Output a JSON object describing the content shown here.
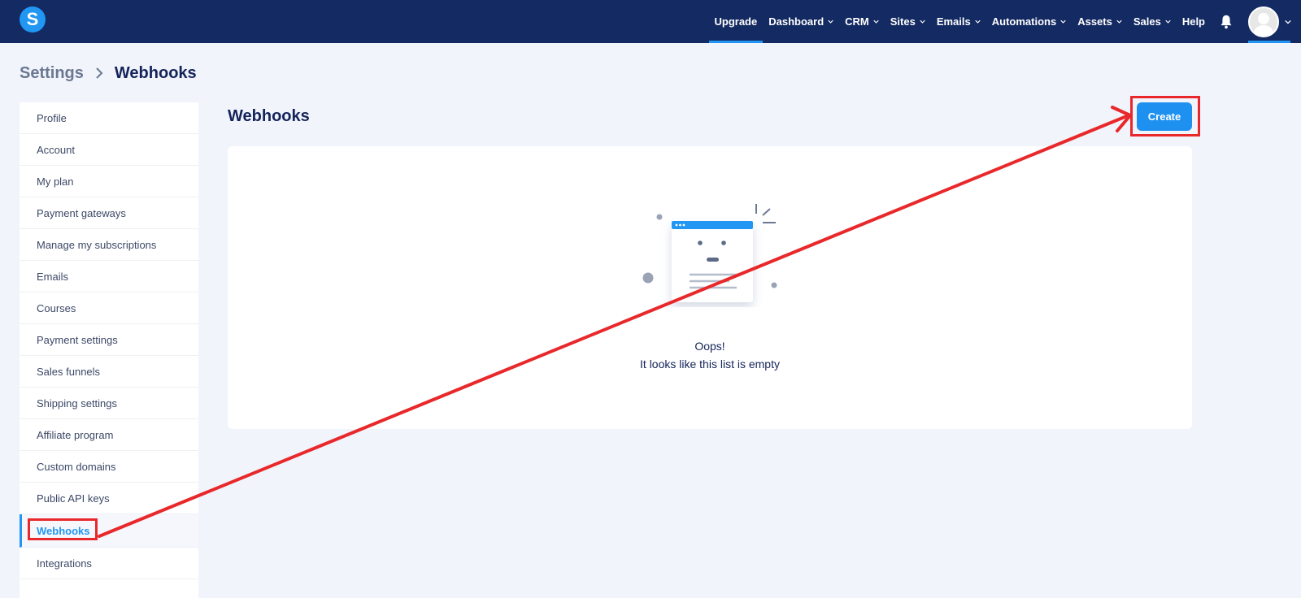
{
  "topbar": {
    "logo_letter": "S",
    "nav": [
      {
        "label": "Upgrade",
        "dropdown": false,
        "active": true
      },
      {
        "label": "Dashboard",
        "dropdown": true
      },
      {
        "label": "CRM",
        "dropdown": true
      },
      {
        "label": "Sites",
        "dropdown": true
      },
      {
        "label": "Emails",
        "dropdown": true
      },
      {
        "label": "Automations",
        "dropdown": true
      },
      {
        "label": "Assets",
        "dropdown": true
      },
      {
        "label": "Sales",
        "dropdown": true
      },
      {
        "label": "Help",
        "dropdown": false
      }
    ],
    "icons": [
      "bell-icon",
      "avatar",
      "chevron-down-icon"
    ]
  },
  "breadcrumb": {
    "parent": "Settings",
    "current": "Webhooks"
  },
  "sidebar": {
    "items": [
      {
        "label": "Profile"
      },
      {
        "label": "Account"
      },
      {
        "label": "My plan"
      },
      {
        "label": "Payment gateways"
      },
      {
        "label": "Manage my subscriptions"
      },
      {
        "label": "Emails"
      },
      {
        "label": "Courses"
      },
      {
        "label": "Payment settings"
      },
      {
        "label": "Sales funnels"
      },
      {
        "label": "Shipping settings"
      },
      {
        "label": "Affiliate program"
      },
      {
        "label": "Custom domains"
      },
      {
        "label": "Public API keys"
      },
      {
        "label": "Webhooks",
        "active": true
      },
      {
        "label": "Integrations"
      }
    ]
  },
  "main": {
    "title": "Webhooks",
    "create_label": "Create",
    "empty_title": "Oops!",
    "empty_subtitle": "It looks like this list is empty"
  },
  "colors": {
    "navbar": "#142a62",
    "accent": "#2196f3",
    "annotation": "#e8282a",
    "background": "#f2f4fb"
  }
}
